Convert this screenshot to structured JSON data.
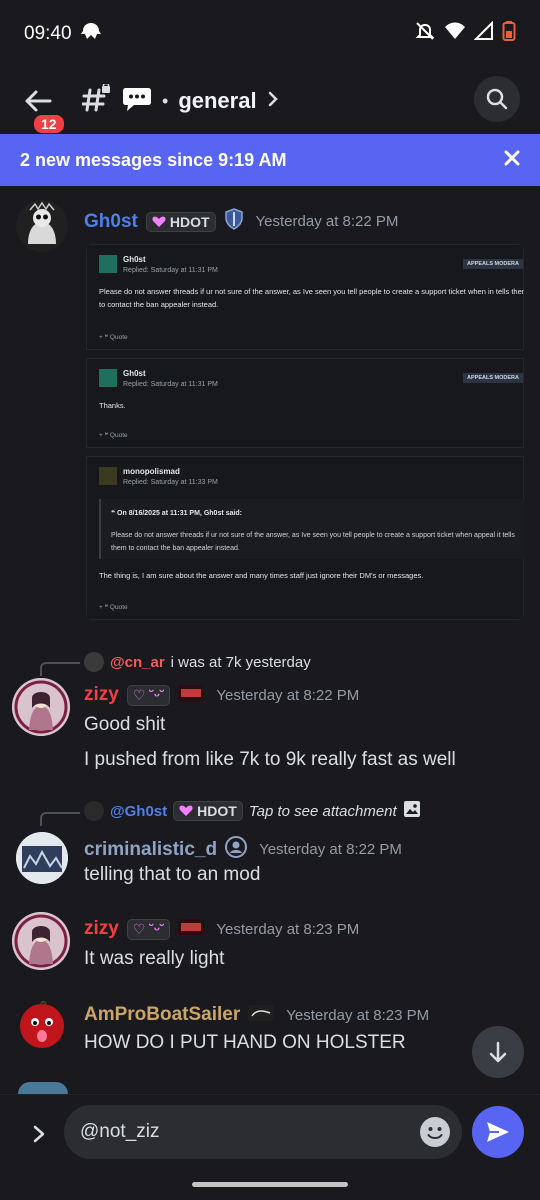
{
  "status": {
    "time": "09:40"
  },
  "header": {
    "unread_count": "12",
    "channel_name": "general"
  },
  "banner": {
    "text": "2 new messages since 9:19 AM"
  },
  "messages": [
    {
      "author": "Gh0st",
      "author_color": "#4f7fe9",
      "tag": "HDOT",
      "timestamp": "Yesterday at 8:22 PM",
      "attachment": {
        "posts": [
          {
            "name": "Gh0st",
            "meta": "Replied: Saturday at 11:31 PM",
            "chip": "APPEALS MODERA",
            "text": "Please do not answer threads if ur not sure of the answer, as Ive seen you tell people to create a support ticket when in tells them to contact the ban appealer instead.",
            "footer": "+    ❝ Quote"
          },
          {
            "name": "Gh0st",
            "meta": "Replied: Saturday at 11:31 PM",
            "chip": "APPEALS MODERA",
            "text": "Thanks.",
            "footer": "+    ❝ Quote"
          },
          {
            "name": "monopolismad",
            "meta": "Replied: Saturday at 11:33 PM",
            "quote_head": "❝  On 8/16/2025 at 11:31 PM, Gh0st said:",
            "quote_text": "Please do not answer threads if ur not sure of the answer, as Ive seen you tell people to create a support ticket when appeal it tells them to contact the ban appealer instead.",
            "text": "The thing is, I am sure about the answer and many times staff just ignore their DM's or messages.",
            "footer": "+    ❝ Quote"
          }
        ]
      }
    },
    {
      "reply_to": "@cn_ar",
      "reply_text": "i was at 7k yesterday",
      "author": "zizy",
      "author_color": "#f23f43",
      "tag": "♡ ˘ᵕ˘",
      "timestamp": "Yesterday at 8:22 PM",
      "lines": [
        "Good shit",
        "I pushed from like 7k to 9k really fast as well"
      ]
    },
    {
      "reply_to": "@Gh0st",
      "reply_tag": "HDOT",
      "reply_text": "Tap to see attachment",
      "author": "criminalistic_d",
      "author_color": "#8fa3c5",
      "timestamp": "Yesterday at 8:22 PM",
      "lines": [
        "telling that to an mod"
      ]
    },
    {
      "author": "zizy",
      "author_color": "#f23f43",
      "tag": "♡ ˘ᵕ˘",
      "timestamp": "Yesterday at 8:23 PM",
      "lines": [
        "It was really light"
      ]
    },
    {
      "author": "AmProBoatSailer",
      "author_color": "#c9a56a",
      "timestamp": "Yesterday at 8:23 PM",
      "lines": [
        "HOW DO I PUT HAND ON HOLSTER"
      ]
    }
  ],
  "composer": {
    "value": "@not_ziz"
  },
  "colors": {
    "accent": "#5865f2",
    "background": "#1a1a1e",
    "badge": "#f23f43"
  }
}
